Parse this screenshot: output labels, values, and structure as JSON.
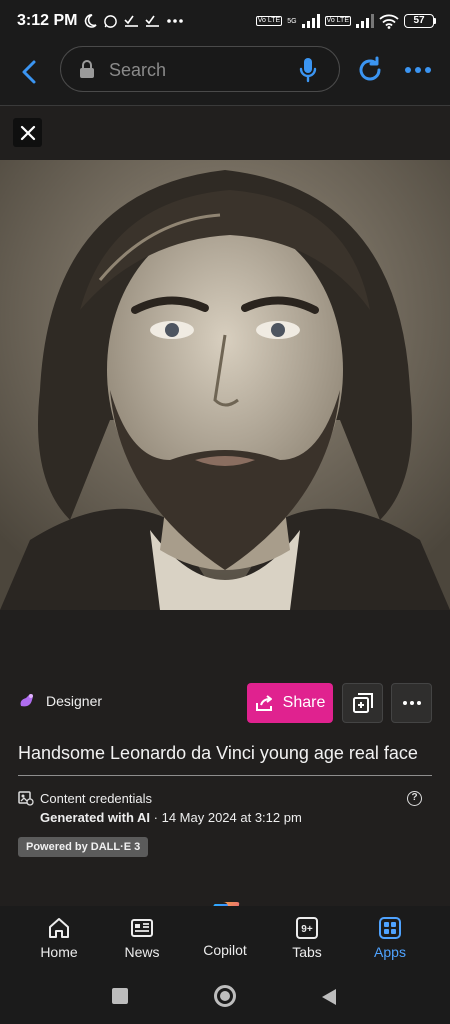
{
  "status": {
    "time": "3:12 PM",
    "battery": "57",
    "network_label_1": "Vo LTE",
    "network_label_2": "5G",
    "network_label_3": "Vo LTE"
  },
  "toolbar": {
    "search_placeholder": "Search"
  },
  "result": {
    "app_name": "Designer",
    "share_label": "Share",
    "prompt": "Handsome Leonardo da Vinci young age real face",
    "credentials_label": "Content credentials",
    "generated_label": "Generated with AI",
    "generated_date": " · 14 May 2024 at 3:12 pm",
    "powered_by": "Powered by DALL·E 3"
  },
  "nav": {
    "items": [
      {
        "label": "Home",
        "icon": "home-icon"
      },
      {
        "label": "News",
        "icon": "news-icon"
      },
      {
        "label": "Copilot",
        "icon": "copilot-icon"
      },
      {
        "label": "Tabs",
        "icon": "tabs-icon",
        "badge": "9+"
      },
      {
        "label": "Apps",
        "icon": "apps-icon",
        "active": true
      }
    ]
  },
  "colors": {
    "accent_share": "#e0228f",
    "active_nav": "#4fa3ff",
    "background": "#211f1e"
  }
}
